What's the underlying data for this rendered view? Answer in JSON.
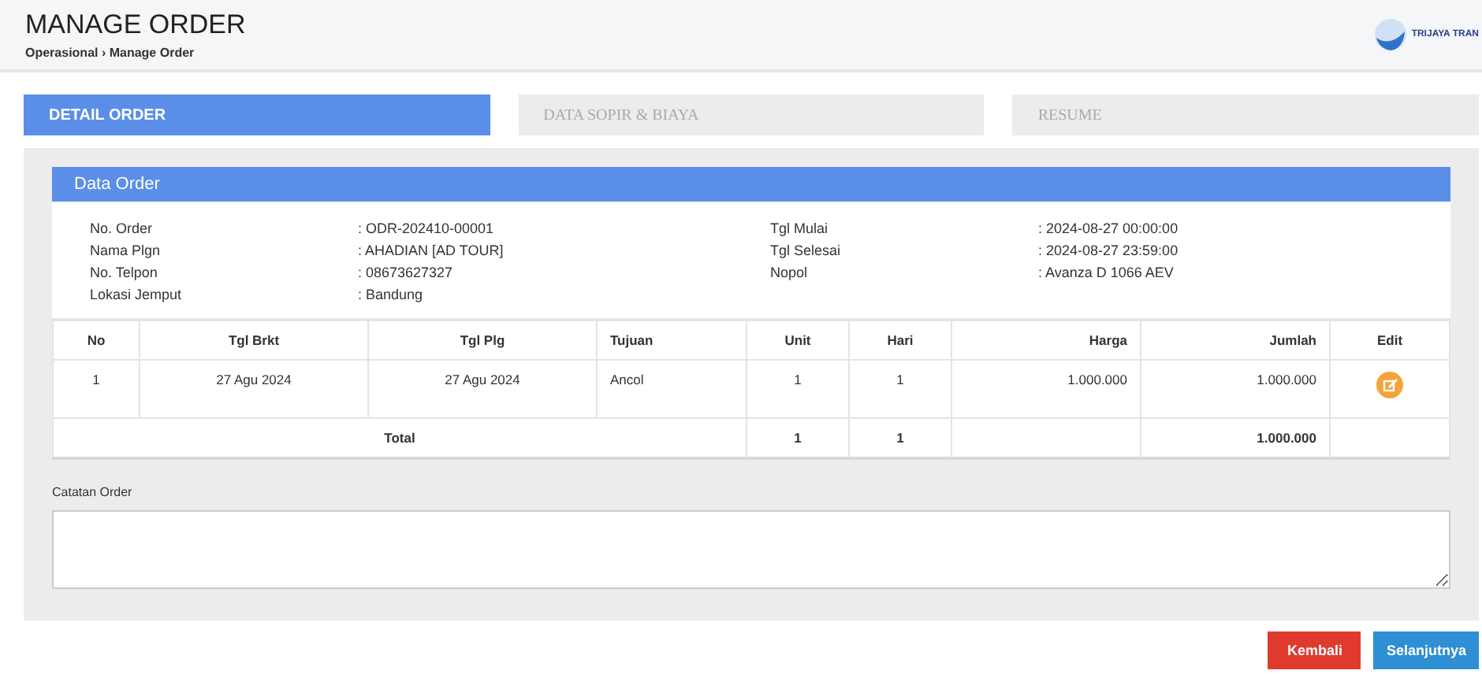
{
  "header": {
    "title": "MANAGE ORDER",
    "breadcrumb": "Operasional › Manage Order",
    "logo_text": "TRIJAYA TRAN"
  },
  "tabs": [
    {
      "label": "DETAIL ORDER",
      "selected": true
    },
    {
      "label": "DATA SOPIR & BIAYA",
      "selected": false
    },
    {
      "label": "RESUME",
      "selected": false
    }
  ],
  "panel": {
    "title": "Data Order",
    "info_left": [
      {
        "label": "No. Order",
        "value": ": ODR-202410-00001"
      },
      {
        "label": "Nama Plgn",
        "value": ": AHADIAN [AD TOUR]"
      },
      {
        "label": "No. Telpon",
        "value": ": 08673627327"
      },
      {
        "label": "Lokasi Jemput",
        "value": ": Bandung"
      }
    ],
    "info_right": [
      {
        "label": "Tgl Mulai",
        "value": ": 2024-08-27 00:00:00"
      },
      {
        "label": "Tgl Selesai",
        "value": ": 2024-08-27 23:59:00"
      },
      {
        "label": "Nopol",
        "value": ": Avanza D 1066 AEV"
      }
    ],
    "table": {
      "columns": [
        "No",
        "Tgl Brkt",
        "Tgl Plg",
        "Tujuan",
        "Unit",
        "Hari",
        "Harga",
        "Jumlah",
        "Edit"
      ],
      "rows": [
        [
          "1",
          "27 Agu 2024",
          "27 Agu 2024",
          "Ancol",
          "1",
          "1",
          "1.000.000",
          "1.000.000"
        ]
      ],
      "total": {
        "label": "Total",
        "unit": "1",
        "hari": "1",
        "jumlah": "1.000.000"
      }
    }
  },
  "notes": {
    "label": "Catatan Order"
  },
  "buttons": [
    {
      "label": "Kembali",
      "kind": "back"
    },
    {
      "label": "Selanjutnya",
      "kind": "next"
    }
  ]
}
